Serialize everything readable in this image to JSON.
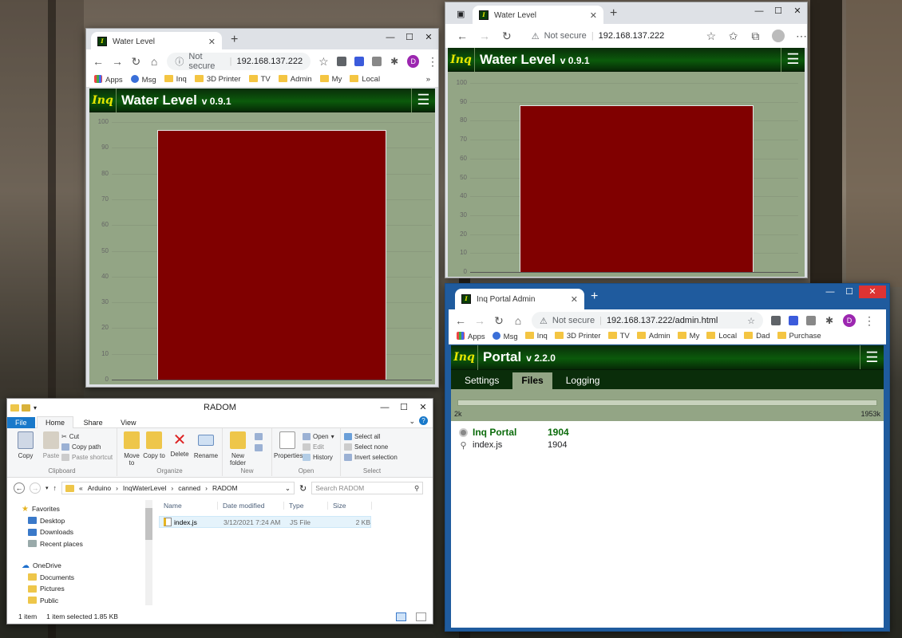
{
  "browser1": {
    "tab_title": "Water Level",
    "url_security": "Not secure",
    "url": "192.168.137.222",
    "avatar": "D",
    "bookmarks": [
      "Apps",
      "Msg",
      "Inq",
      "3D Printer",
      "TV",
      "Admin",
      "My",
      "Local"
    ],
    "bookmark_more": "»",
    "app_logo": "Inq",
    "app_title": "Water Level",
    "app_version": "v 0.9.1"
  },
  "browser2": {
    "tab_title": "Water Level",
    "url_security": "Not secure",
    "url": "192.168.137.222",
    "app_logo": "Inq",
    "app_title": "Water Level",
    "app_version": "v 0.9.1"
  },
  "chart_data": [
    {
      "type": "bar",
      "categories": [
        ""
      ],
      "values": [
        97
      ],
      "ylim": [
        0,
        100
      ],
      "yticks": [
        0,
        10,
        20,
        30,
        40,
        50,
        60,
        70,
        80,
        90,
        100
      ],
      "grid": true,
      "color": "#800000"
    },
    {
      "type": "bar",
      "categories": [
        ""
      ],
      "values": [
        88
      ],
      "ylim": [
        0,
        100
      ],
      "yticks": [
        0,
        10,
        20,
        30,
        40,
        50,
        60,
        70,
        80,
        90,
        100
      ],
      "grid": true,
      "color": "#800000"
    }
  ],
  "portal": {
    "tab_title": "Inq Portal Admin",
    "url_security": "Not secure",
    "url": "192.168.137.222/admin.html",
    "avatar": "D",
    "bookmarks": [
      "Apps",
      "Msg",
      "Inq",
      "3D Printer",
      "TV",
      "Admin",
      "My",
      "Local",
      "Dad",
      "Purchase"
    ],
    "app_logo": "Inq",
    "app_title": "Portal",
    "app_version": "v 2.2.0",
    "tabs": [
      "Settings",
      "Files",
      "Logging"
    ],
    "active_tab": "Files",
    "storage_min": "2k",
    "storage_max": "1953k",
    "storage_used_fraction": 0.0,
    "tree_root": {
      "name": "Inq Portal",
      "value": "1904"
    },
    "tree_files": [
      {
        "name": "index.js",
        "value": "1904"
      }
    ]
  },
  "explorer": {
    "title": "RADOM",
    "ribbon_tabs": [
      "File",
      "Home",
      "Share",
      "View"
    ],
    "clipboard": {
      "copy": "Copy",
      "paste": "Paste",
      "cut": "Cut",
      "copy_path": "Copy path",
      "paste_shortcut": "Paste shortcut",
      "group": "Clipboard"
    },
    "organize": {
      "move": "Move to",
      "copy": "Copy to",
      "delete": "Delete",
      "rename": "Rename",
      "group": "Organize"
    },
    "new": {
      "new_folder": "New folder",
      "group": "New"
    },
    "open": {
      "properties": "Properties",
      "open": "Open",
      "edit": "Edit",
      "history": "History",
      "group": "Open"
    },
    "select": {
      "all": "Select all",
      "none": "Select none",
      "invert": "Invert selection",
      "group": "Select"
    },
    "path": [
      "«",
      "Arduino",
      "InqWaterLevel",
      "canned",
      "RADOM"
    ],
    "search_placeholder": "Search RADOM",
    "nav": {
      "favorites": "Favorites",
      "favorite_items": [
        "Desktop",
        "Downloads",
        "Recent places"
      ],
      "onedrive": "OneDrive",
      "onedrive_items": [
        "Documents",
        "Pictures",
        "Public"
      ]
    },
    "columns": [
      "Name",
      "Date modified",
      "Type",
      "Size"
    ],
    "files": [
      {
        "name": "index.js",
        "date": "3/12/2021 7:24 AM",
        "type": "JS File",
        "size": "2 KB"
      }
    ],
    "status_count": "1 item",
    "status_selected": "1 item selected  1.85 KB"
  }
}
